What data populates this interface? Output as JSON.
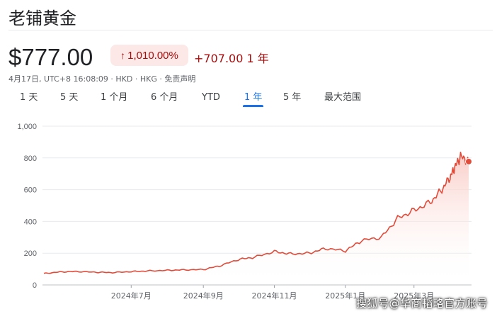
{
  "header": {
    "title": "老铺黄金",
    "price": "$777.00",
    "change_arrow": "↑",
    "change_pct": "1,010.00%",
    "change_abs": "+707.00",
    "change_period": "1 年",
    "meta": "4月17日, UTC+8 16:08:09 · HKD · HKG · 免责声明"
  },
  "tabs": [
    {
      "label": "1 天",
      "active": false
    },
    {
      "label": "5 天",
      "active": false
    },
    {
      "label": "1 个月",
      "active": false
    },
    {
      "label": "6 个月",
      "active": false
    },
    {
      "label": "YTD",
      "active": false
    },
    {
      "label": "1 年",
      "active": true
    },
    {
      "label": "5 年",
      "active": false
    },
    {
      "label": "最大范围",
      "active": false
    }
  ],
  "colors": {
    "line": "#e14b3a",
    "fill_top": "#f9c9c3",
    "grid": "#e8eaed",
    "axis_text": "#5f6368",
    "active_tab": "#1a73e8",
    "negative_bg": "#fce8e6",
    "negative_text": "#a50e0e"
  },
  "watermark": "搜狐号@华商韬略官方账号",
  "chart_data": {
    "type": "area",
    "x_ticks": [
      "2024年7月",
      "2024年9月",
      "2024年11月",
      "2025年1月",
      "2025年3月"
    ],
    "y_ticks": [
      "0",
      "200",
      "400",
      "600",
      "800",
      "1,000"
    ],
    "ylim": [
      0,
      1000
    ],
    "grid": true,
    "x": [
      "2024-04-17",
      "2024-05-01",
      "2024-05-15",
      "2024-06-01",
      "2024-06-15",
      "2024-07-01",
      "2024-07-15",
      "2024-08-01",
      "2024-08-15",
      "2024-09-01",
      "2024-09-15",
      "2024-10-01",
      "2024-10-15",
      "2024-11-01",
      "2024-11-15",
      "2024-12-01",
      "2024-12-15",
      "2025-01-01",
      "2025-01-15",
      "2025-02-01",
      "2025-02-15",
      "2025-03-01",
      "2025-03-15",
      "2025-03-25",
      "2025-04-01",
      "2025-04-05",
      "2025-04-10",
      "2025-04-17"
    ],
    "values": [
      72,
      82,
      85,
      80,
      78,
      84,
      88,
      92,
      95,
      97,
      120,
      160,
      175,
      210,
      195,
      200,
      230,
      215,
      280,
      300,
      420,
      470,
      520,
      600,
      680,
      740,
      810,
      777
    ]
  }
}
